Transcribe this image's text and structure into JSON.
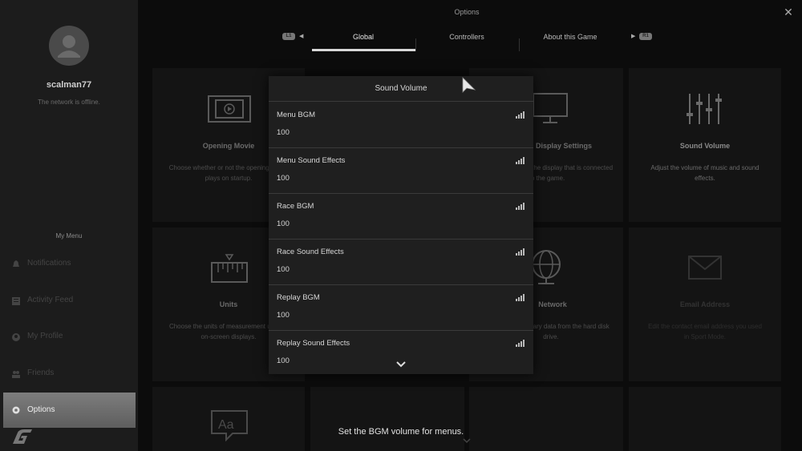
{
  "window": {
    "title": "Options"
  },
  "profile": {
    "username": "scalman77",
    "status": "The network is offline."
  },
  "sidebar": {
    "section_label": "My Menu",
    "items": [
      {
        "label": "Notifications",
        "icon": "bell-icon"
      },
      {
        "label": "Activity Feed",
        "icon": "feed-icon"
      },
      {
        "label": "My Profile",
        "icon": "profile-icon"
      },
      {
        "label": "Friends",
        "icon": "friends-icon"
      },
      {
        "label": "Options",
        "icon": "gear-icon",
        "active": true
      }
    ]
  },
  "tabs": {
    "left_button": "L1",
    "right_button": "R1",
    "items": [
      {
        "label": "Global",
        "active": true
      },
      {
        "label": "Controllers"
      },
      {
        "label": "About this Game"
      }
    ]
  },
  "cards": [
    {
      "title": "Opening Movie",
      "desc": "Choose whether or not the opening movie plays on startup.",
      "icon": "film-icon"
    },
    {
      "title": "Display Settings",
      "desc": "Make settings for the display that is connected to the game.",
      "icon": "monitor-icon"
    },
    {
      "title": "Sound Volume",
      "desc": "Adjust the volume of music and sound effects.",
      "icon": "sliders-icon"
    },
    {
      "title": "Units",
      "desc": "Choose the units of measurement used in on-screen displays.",
      "icon": "ruler-icon"
    },
    {
      "title": "Network",
      "desc": "Delete temporary data from the hard disk drive.",
      "icon": "globe-icon"
    },
    {
      "title": "Email Address",
      "desc": "Edit the contact email address you used in Sport Mode.",
      "icon": "mail-icon"
    }
  ],
  "modal": {
    "title": "Sound Volume",
    "rows": [
      {
        "label": "Menu BGM",
        "value": "100"
      },
      {
        "label": "Menu Sound Effects",
        "value": "100"
      },
      {
        "label": "Race BGM",
        "value": "100"
      },
      {
        "label": "Race Sound Effects",
        "value": "100"
      },
      {
        "label": "Replay BGM",
        "value": "100"
      },
      {
        "label": "Replay Sound Effects",
        "value": "100"
      }
    ]
  },
  "hint": "Set the BGM volume for menus.",
  "colors": {
    "accent_active": "#7d7d7d",
    "background": "#0c0c0c",
    "modal": "#1f1f1f"
  }
}
